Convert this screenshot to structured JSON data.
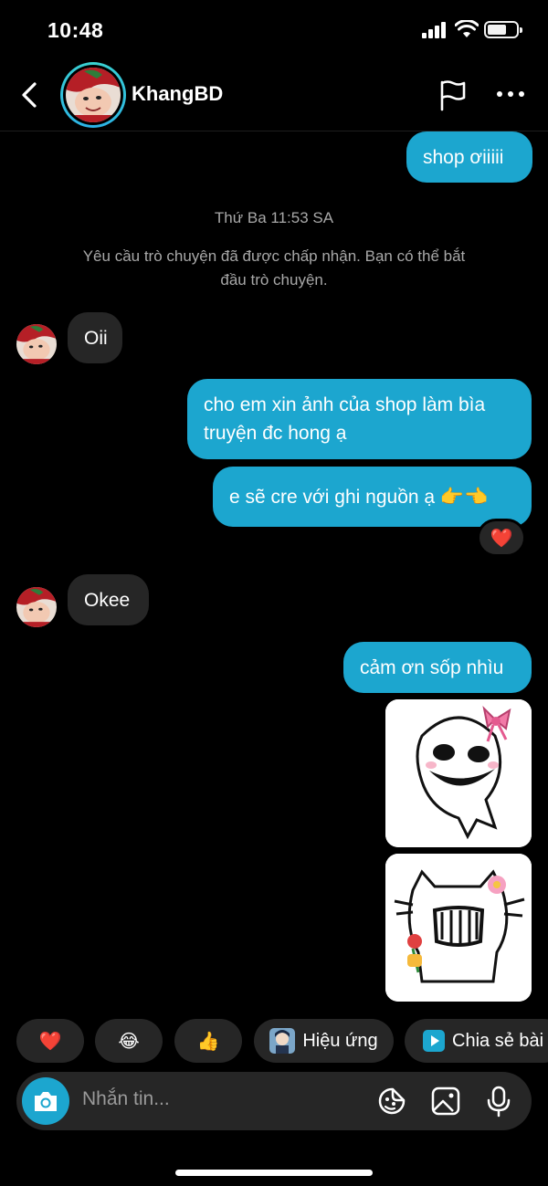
{
  "status": {
    "time": "10:48"
  },
  "header": {
    "name": "KhangBD"
  },
  "messages": {
    "m1": "shop ơiiiii",
    "timestamp": "Thứ Ba 11:53 SA",
    "system_line1": "Yêu cầu trò chuyện đã được chấp nhận. Bạn có thể bắt",
    "system_line2": "đầu trò chuyện.",
    "m2": "Oii",
    "m3_line1": "cho em xin ảnh của shop làm bìa",
    "m3_line2": "truyện đc hong ạ",
    "m4": "e sẽ cre với ghi nguồn ạ 👉👈",
    "m4_reaction": "❤️",
    "m5": "Okee",
    "m6": "cảm ơn sốp nhìu"
  },
  "quick": {
    "heart": "❤️",
    "laugh": "😂",
    "thumbs": "👍",
    "effects": "Hiệu ứng",
    "share": "Chia sẻ bài"
  },
  "composer": {
    "placeholder": "Nhắn tin..."
  },
  "colors": {
    "accent": "#1ca6cf",
    "incoming": "#262626",
    "background": "#000000"
  }
}
